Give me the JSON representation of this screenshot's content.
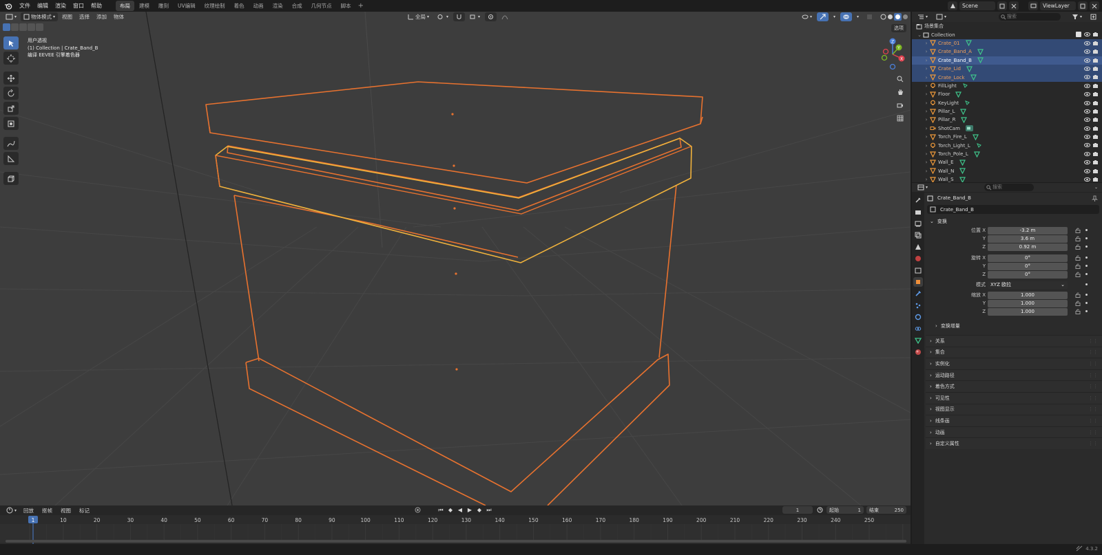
{
  "menubar": {
    "items": [
      "文件",
      "编辑",
      "渲染",
      "窗口",
      "帮助"
    ],
    "workspaces": [
      "布局",
      "建模",
      "雕刻",
      "UV编辑",
      "纹理绘制",
      "着色",
      "动画",
      "渲染",
      "合成",
      "几何节点",
      "脚本"
    ],
    "active_workspace": "布局",
    "scene": "Scene",
    "view_layer": "ViewLayer"
  },
  "viewport": {
    "mode_label": "物体模式",
    "menus": [
      "视图",
      "选择",
      "添加",
      "物体"
    ],
    "transform_orientation": "全局",
    "options_label": "选项",
    "info_line1": "用户透视",
    "info_line2": "(1) Collection | Crate_Band_B",
    "info_line3": "编译 EEVEE 引擎着色器",
    "selection_color": "#e8722f",
    "active_color": "#f0b23c"
  },
  "timeline": {
    "menus": [
      "回放",
      "抠帧",
      "视图",
      "标记"
    ],
    "current_frame": "1",
    "start_label": "起始",
    "start": "1",
    "end_label": "结束",
    "end": "250",
    "ticks": [
      "1",
      "10",
      "20",
      "30",
      "40",
      "50",
      "60",
      "70",
      "80",
      "90",
      "100",
      "110",
      "120",
      "130",
      "140",
      "150",
      "160",
      "170",
      "180",
      "190",
      "200",
      "210",
      "220",
      "230",
      "240",
      "250"
    ]
  },
  "outliner": {
    "search_placeholder": "搜索",
    "root_label": "场景集合",
    "collection_label": "Collection",
    "items": [
      {
        "name": "Crate_01",
        "state": "sel",
        "type": "mesh"
      },
      {
        "name": "Crate_Band_A",
        "state": "sel",
        "type": "mesh"
      },
      {
        "name": "Crate_Band_B",
        "state": "active",
        "type": "mesh"
      },
      {
        "name": "Crate_Lid",
        "state": "sel",
        "type": "mesh"
      },
      {
        "name": "Crate_Lock",
        "state": "sel",
        "type": "mesh"
      },
      {
        "name": "FillLight",
        "state": "",
        "type": "light"
      },
      {
        "name": "Floor",
        "state": "",
        "type": "mesh"
      },
      {
        "name": "KeyLight",
        "state": "",
        "type": "light"
      },
      {
        "name": "Pillar_L",
        "state": "",
        "type": "mesh"
      },
      {
        "name": "Pillar_R",
        "state": "",
        "type": "mesh"
      },
      {
        "name": "ShotCam",
        "state": "",
        "type": "camera"
      },
      {
        "name": "Torch_Fire_L",
        "state": "",
        "type": "mesh"
      },
      {
        "name": "Torch_Light_L",
        "state": "",
        "type": "light"
      },
      {
        "name": "Torch_Pole_L",
        "state": "",
        "type": "mesh"
      },
      {
        "name": "Wall_E",
        "state": "",
        "type": "mesh"
      },
      {
        "name": "Wall_N",
        "state": "",
        "type": "mesh"
      },
      {
        "name": "Wall_S",
        "state": "",
        "type": "mesh"
      }
    ]
  },
  "properties": {
    "search_placeholder": "搜索",
    "context_name": "Crate_Band_B",
    "object_name": "Crate_Band_B",
    "transform_label": "变换",
    "location_label": "位置 X",
    "rotation_label": "旋转 X",
    "scale_label": "缩放 X",
    "y_label": "Y",
    "z_label": "Z",
    "location": [
      "-3.2 m",
      "3.6 m",
      "0.92 m"
    ],
    "rotation": [
      "0°",
      "0°",
      "0°"
    ],
    "mode_label": "模式",
    "rotation_mode": "XYZ 欧拉",
    "scale": [
      "1.000",
      "1.000",
      "1.000"
    ],
    "delta_label": "变换增量",
    "panels": [
      "关系",
      "集合",
      "实例化",
      "运动路径",
      "着色方式",
      "可见性",
      "视图显示",
      "线条画",
      "动画",
      "自定义属性"
    ]
  },
  "statusbar": {
    "version": "4.3.2"
  }
}
